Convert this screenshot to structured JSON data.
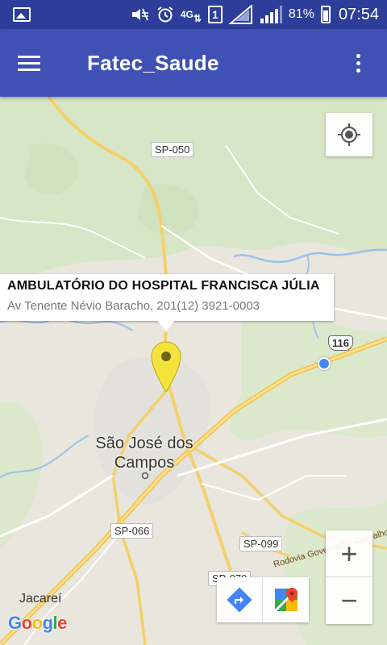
{
  "status_bar": {
    "network": "4G",
    "sim_slot": "1",
    "battery": "81%",
    "time": "07:54",
    "icons": [
      "gallery-icon",
      "mute-icon",
      "alarm-icon",
      "lte-icon",
      "sim-icon",
      "signal-empty-icon",
      "signal-icon",
      "battery-icon"
    ]
  },
  "app_bar": {
    "title": "Fatec_Saude",
    "menu_icon": "hamburger-menu-icon",
    "overflow_icon": "more-vert-icon",
    "color": "#3f51b5"
  },
  "map": {
    "info_window": {
      "title": "AMBULATÓRIO DO HOSPITAL FRANCISCA JÚLIA",
      "snippet": "Av Tenente Névio Baracho, 201(12) 3921-0003"
    },
    "marker_color": "#f4e33b",
    "road_labels": {
      "sp050": "SP-050",
      "sp066": "SP-066",
      "sp099": "SP-099",
      "sp070": "SP-070",
      "br116": "116"
    },
    "road_name": "Rodovia Governador Carvalho Pinto",
    "city": "São José dos Campos",
    "town": "Jacareí",
    "attribution": "Google",
    "controls": {
      "zoom_in": "+",
      "zoom_out": "−"
    }
  }
}
